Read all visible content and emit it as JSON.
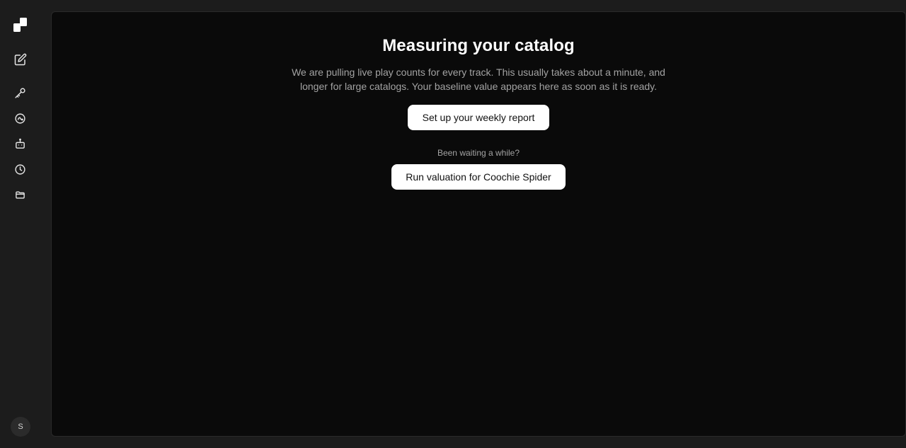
{
  "sidebar": {
    "logo_icon": "app-logo",
    "nav_items": [
      {
        "icon": "edit-icon"
      },
      {
        "icon": "key-icon"
      },
      {
        "icon": "gauge-icon"
      },
      {
        "icon": "robot-icon"
      },
      {
        "icon": "clock-icon"
      },
      {
        "icon": "folder-icon"
      }
    ],
    "avatar_initial": "S"
  },
  "main": {
    "title": "Measuring your catalog",
    "description": "We are pulling live play counts for every track. This usually takes about a minute, and longer for large catalogs. Your baseline value appears here as soon as it is ready.",
    "report_button_label": "Set up your weekly report",
    "waiting_text": "Been waiting a while?",
    "run_button_label": "Run valuation for Coochie Spider"
  },
  "colors": {
    "page_background": "#1c1c1c",
    "panel_background": "#0a0a0a",
    "muted_text": "#a3a3a3",
    "button_background": "#ffffff"
  }
}
